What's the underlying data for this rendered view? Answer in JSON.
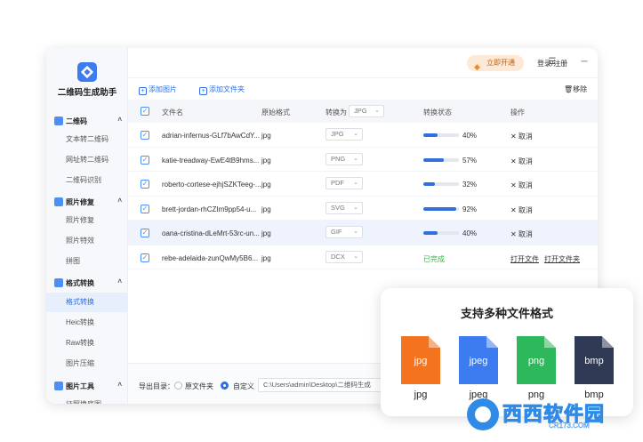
{
  "app": {
    "title": "二维码生成助手"
  },
  "sidebar": {
    "groups": [
      {
        "label": "二维码",
        "items": [
          "文本转二维码",
          "网址转二维码",
          "二维码识别"
        ]
      },
      {
        "label": "照片修复",
        "items": [
          "照片修复",
          "照片特效",
          "拼图"
        ]
      },
      {
        "label": "格式转换",
        "items": [
          "格式转换",
          "Heic转换",
          "Raw转换",
          "图片压缩"
        ]
      },
      {
        "label": "图片工具",
        "items": [
          "证照换底图"
        ]
      }
    ],
    "active_item": "格式转换"
  },
  "topbar": {
    "vip_label": "立即开通",
    "login_label": "登录/注册"
  },
  "toolbar": {
    "add_image": "添加图片",
    "add_folder": "添加文件夹",
    "remove": "移除"
  },
  "table": {
    "headers": {
      "name": "文件名",
      "orig": "原始格式",
      "convert_to": "转换为",
      "status": "转换状态",
      "action": "操作"
    },
    "header_format": "JPG",
    "rows": [
      {
        "name": "adrian-infernus-GLf7bAwCdY...",
        "orig": "jpg",
        "target": "JPG",
        "progress": 0.4,
        "pct": "40%",
        "action": "✕ 取消"
      },
      {
        "name": "katie-treadway-EwE4tB9hms...",
        "orig": "jpg",
        "target": "PNG",
        "progress": 0.57,
        "pct": "57%",
        "action": "✕ 取消"
      },
      {
        "name": "roberto-cortese-ejhjSZKTeeg-...",
        "orig": "jpg",
        "target": "PDF",
        "progress": 0.32,
        "pct": "32%",
        "action": "✕ 取消"
      },
      {
        "name": "brett-jordan-rhCZIm9pp54-u...",
        "orig": "jpg",
        "target": "SVG",
        "progress": 0.92,
        "pct": "92%",
        "action": "✕ 取消"
      },
      {
        "name": "oana-cristina-dLeMrt-53rc-un...",
        "orig": "jpg",
        "target": "GIF",
        "progress": 0.4,
        "pct": "40%",
        "action": "✕ 取消"
      },
      {
        "name": "rebe-adelaida-zunQwMy5B6...",
        "orig": "jpg",
        "target": "DCX",
        "status": "已完成",
        "open_file": "打开文件",
        "open_folder": "打开文件夹"
      }
    ]
  },
  "footer": {
    "export_label": "导出目录：",
    "option_original": "原文件夹",
    "option_custom": "自定义",
    "path": "C:\\Users\\admin\\Desktop\\二维码生成"
  },
  "card": {
    "title": "支持多种文件格式",
    "formats": [
      {
        "ext": "jpg",
        "label": "jpg",
        "color": "#f4731f"
      },
      {
        "ext": "jpeg",
        "label": "jpeg",
        "color": "#3d7bf0"
      },
      {
        "ext": "png",
        "label": "png",
        "color": "#2db85c"
      },
      {
        "ext": "bmp",
        "label": "bmp",
        "color": "#2f3a55"
      }
    ]
  },
  "watermark": {
    "text": "西西软件园",
    "sub": "CR173.COM"
  }
}
